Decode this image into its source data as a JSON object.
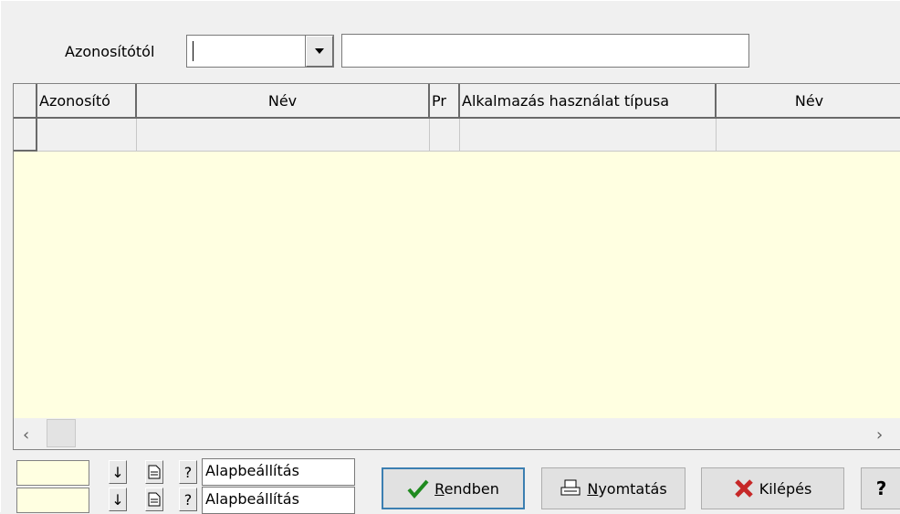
{
  "filter": {
    "label": "Azonosítótól",
    "id_value": "",
    "name_value": ""
  },
  "grid": {
    "columns": [
      "Azonosító",
      "Név",
      "Pr",
      "Alkalmazás használat típusa",
      "Név"
    ],
    "rows": [
      [
        "",
        "",
        "",
        "",
        ""
      ]
    ]
  },
  "settings": [
    {
      "color": "",
      "name": "Alapbeállítás"
    },
    {
      "color": "",
      "name": "Alapbeállítás"
    }
  ],
  "buttons": {
    "ok_first": "R",
    "ok_rest": "endben",
    "print_first": "N",
    "print_rest": "yomtatás",
    "exit": "Kilépés",
    "help": "?"
  },
  "icons": {
    "ok": "checkmark-icon",
    "print": "printer-icon",
    "exit": "x-icon",
    "sort": "down-arrow-icon",
    "doc": "document-icon",
    "help": "question-icon"
  },
  "colors": {
    "grid_bg": "#ffffe1",
    "check": "#1f8a1f",
    "exit": "#c62828"
  }
}
